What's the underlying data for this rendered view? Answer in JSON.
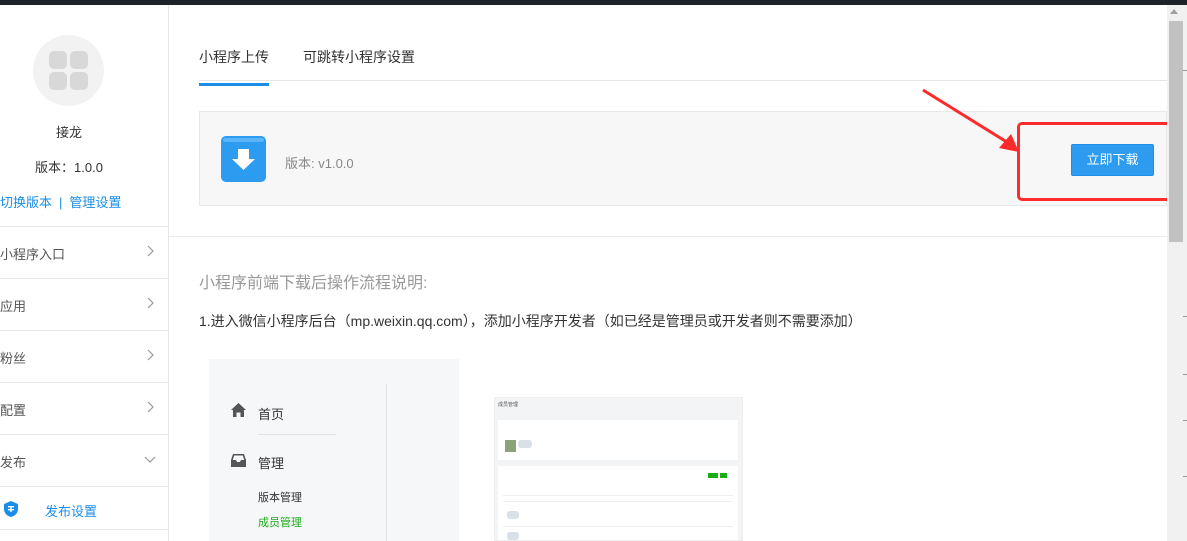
{
  "sidebar": {
    "app_name": "接龙",
    "version_label": "版本：1.0.0",
    "switch_version": "切换版本",
    "link_separator": "|",
    "manage_settings": "管理设置",
    "nav": [
      {
        "label": "小程序入口",
        "expanded": false
      },
      {
        "label": "应用",
        "expanded": false
      },
      {
        "label": "粉丝",
        "expanded": false
      },
      {
        "label": "配置",
        "expanded": false
      },
      {
        "label": "发布",
        "expanded": true
      }
    ],
    "sub_item": {
      "label": "发布设置",
      "icon": "shield-icon"
    }
  },
  "tabs": [
    {
      "label": "小程序上传",
      "active": true
    },
    {
      "label": "可跳转小程序设置",
      "active": false
    }
  ],
  "download": {
    "version_text": "版本: v1.0.0",
    "button_label": "立即下载"
  },
  "guide": {
    "title": "小程序前端下载后操作流程说明:",
    "step1": "1.进入微信小程序后台（mp.weixin.qq.com），添加小程序开发者（如已经是管理员或开发者则不需要添加）"
  },
  "screenshot1": {
    "home": "首页",
    "manage": "管理",
    "version_manage": "版本管理",
    "member_manage": "成员管理"
  },
  "screenshot2": {
    "title": "成员管理"
  },
  "colors": {
    "accent": "#1a8ee8",
    "highlight": "#ff2b2b",
    "success": "#1aad19"
  }
}
